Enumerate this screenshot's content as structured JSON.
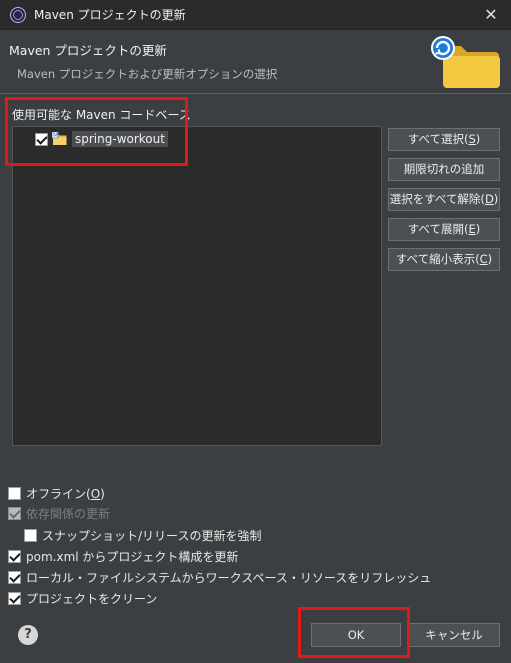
{
  "window": {
    "title": "Maven プロジェクトの更新",
    "close_symbol": "✕"
  },
  "header": {
    "title": "Maven プロジェクトの更新",
    "description": "Maven プロジェクトおよび更新オプションの選択",
    "icon": "folder-refresh-icon"
  },
  "codebase": {
    "label": "使用可能な Maven コードベース",
    "items": [
      {
        "label": "spring-workout",
        "checked": true,
        "icon": "maven-project-icon"
      }
    ]
  },
  "side_buttons": [
    {
      "label": "すべて選択(",
      "mnemonic": "S",
      "suffix": ")"
    },
    {
      "label": "期限切れの追加",
      "mnemonic": "",
      "suffix": ""
    },
    {
      "label": "選択をすべて解除(",
      "mnemonic": "D",
      "suffix": ")"
    },
    {
      "label": "すべて展開(",
      "mnemonic": "E",
      "suffix": ")"
    },
    {
      "label": "すべて縮小表示(",
      "mnemonic": "C",
      "suffix": ")"
    }
  ],
  "options": {
    "offline": {
      "label": "オフライン(",
      "mnemonic": "O",
      "suffix": ")",
      "checked": false
    },
    "update_dependencies": {
      "label": "依存関係の更新",
      "checked": true,
      "enabled": false
    },
    "force_snapshot": {
      "label": "スナップショット/リリースの更新を強制",
      "checked": false
    },
    "update_config": {
      "label": "pom.xml からプロジェクト構成を更新",
      "checked": true
    },
    "refresh_workspace": {
      "label": "ローカル・ファイルシステムからワークスペース・リソースをリフレッシュ",
      "checked": true
    },
    "clean_projects": {
      "label": "プロジェクトをクリーン",
      "checked": true
    }
  },
  "footer": {
    "help_symbol": "?",
    "ok_label": "OK",
    "cancel_label": "キャンセル"
  },
  "colors": {
    "background": "#3c3f41",
    "tree_background": "#2b2b2b",
    "highlight": "#e11919",
    "folder": "#f2c744",
    "refresh_badge": "#1e7ad8"
  }
}
